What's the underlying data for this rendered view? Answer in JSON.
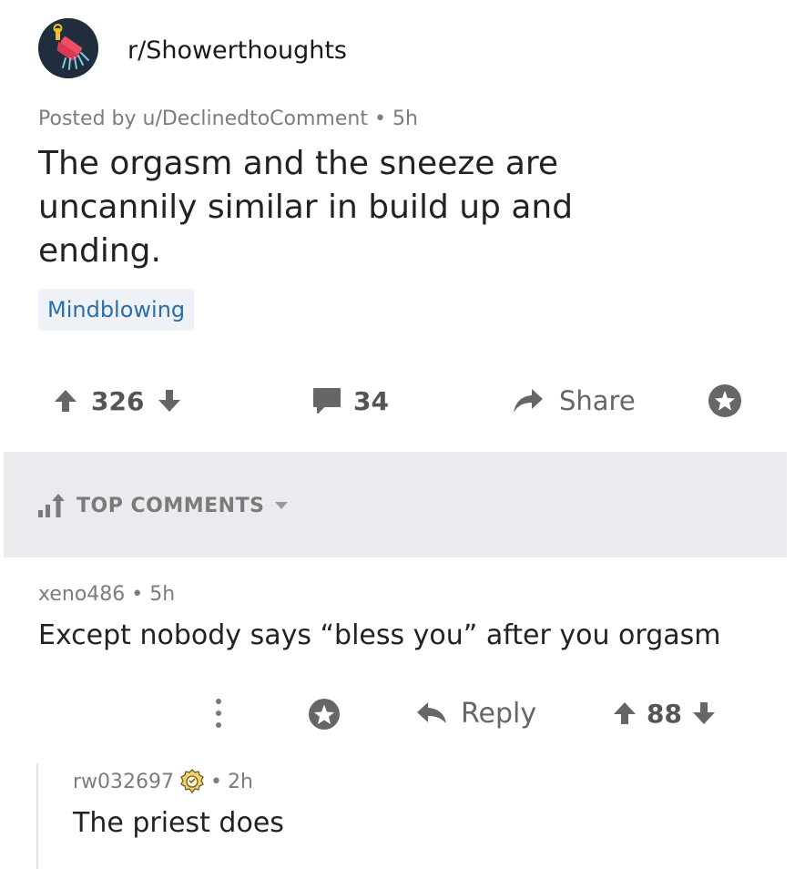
{
  "post": {
    "subreddit": "r/Showerthoughts",
    "posted_by": "Posted by u/DeclinedtoComment",
    "age": "5h",
    "title": "The orgasm and the sneeze are uncannily similar in build up and ending.",
    "flair": "Mindblowing",
    "score": "326",
    "comments": "34",
    "share_label": "Share"
  },
  "sort": {
    "label": "TOP COMMENTS"
  },
  "comments": [
    {
      "author": "xeno486",
      "age": "5h",
      "body": "Except nobody says “bless you” after you orgasm",
      "reply_label": "Reply",
      "score": "88"
    },
    {
      "author": "rw032697",
      "age": "2h",
      "body": "The priest does"
    }
  ],
  "icons": {
    "avatar": "shower-head-icon",
    "upvote": "arrow-up-icon",
    "downvote": "arrow-down-icon",
    "comment": "speech-bubble-icon",
    "share": "share-arrow-icon",
    "save": "star-icon",
    "sort": "bar-chart-icon",
    "dropdown": "caret-down-icon",
    "more": "vertical-dots-icon",
    "reply": "reply-arrow-icon",
    "award": "award-badge-icon"
  },
  "colors": {
    "flair_text": "#2a6fa8",
    "flair_bg": "#eef1f6",
    "sort_bar_bg": "#e9ebee",
    "avatar_bg": "#1f2d3d",
    "avatar_accent": "#f04e63"
  }
}
